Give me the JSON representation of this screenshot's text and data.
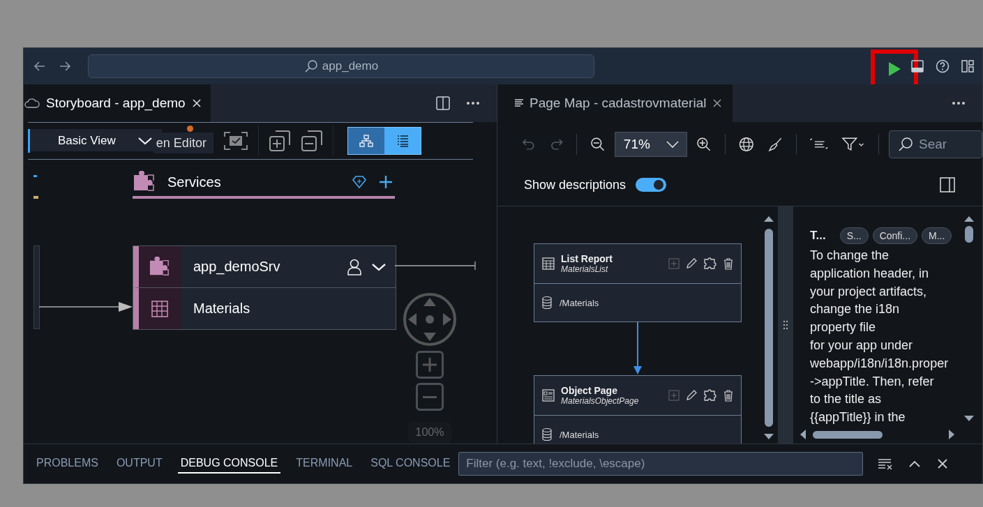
{
  "top_bar": {
    "search": "app_demo"
  },
  "storyboard": {
    "tab": "Storyboard - app_demo",
    "view_select": "Basic View",
    "covered_button": "en Editor",
    "layout_toggle": [
      {
        "selected": false
      },
      {
        "selected": true
      }
    ],
    "services_header": "Services",
    "nodes": [
      {
        "label": "app_demoSrv",
        "kind": "service"
      },
      {
        "label": "Materials",
        "kind": "entity"
      }
    ],
    "zoom": "100%"
  },
  "page_map": {
    "tab": "Page Map - cadastrovmaterial",
    "zoom": "71%",
    "search_placeholder": "Sear",
    "show_descriptions": {
      "label": "Show descriptions",
      "on": true
    },
    "pages": [
      {
        "title": "List Report",
        "subtitle": "MaterialsList",
        "entity": "/Materials",
        "kind": "list"
      },
      {
        "title": "Object Page",
        "subtitle": "MaterialsObjectPage",
        "entity": "/Materials",
        "kind": "object"
      }
    ]
  },
  "description": {
    "title": "T...",
    "tags": [
      "S...",
      "Confi...",
      "M..."
    ],
    "text": "To change the\napplication header, in\nyour project artifacts,\nchange the i18n\nproperty file\nfor your app under\nwebapp/i18n/i18n.proper\n->appTitle. Then, refer\nto the title as\n{{appTitle}} in the"
  },
  "bottom_panel": {
    "tabs": [
      {
        "label": "PROBLEMS",
        "selected": false
      },
      {
        "label": "OUTPUT",
        "selected": false
      },
      {
        "label": "DEBUG CONSOLE",
        "selected": true
      },
      {
        "label": "TERMINAL",
        "selected": false
      },
      {
        "label": "SQL CONSOLE",
        "selected": false
      }
    ],
    "filter_placeholder": "Filter (e.g. text, !exclude, \\escape)"
  }
}
